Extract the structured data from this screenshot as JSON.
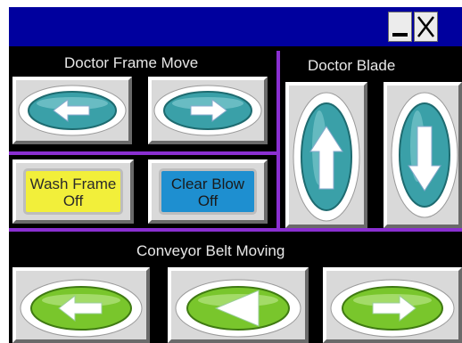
{
  "window": {
    "minimize_icon": "minimize-icon",
    "close_icon": "close-icon",
    "titlebar_color": "#00009e"
  },
  "doctor_frame_move": {
    "title": "Doctor Frame Move",
    "buttons": [
      {
        "icon": "arrow-left-icon",
        "color": "#3aa0a8"
      },
      {
        "icon": "arrow-right-icon",
        "color": "#3aa0a8"
      }
    ]
  },
  "doctor_blade": {
    "title": "Doctor Blade",
    "buttons": [
      {
        "icon": "arrow-up-icon",
        "color": "#3aa0a8"
      },
      {
        "icon": "arrow-down-icon",
        "color": "#3aa0a8"
      }
    ]
  },
  "wash_frame": {
    "label": "Wash Frame",
    "state": "Off",
    "color": "#f2ef3a"
  },
  "clear_blow": {
    "label": "Clear Blow",
    "state": "Off",
    "color": "#1e8fd0"
  },
  "conveyor_belt": {
    "title": "Conveyor Belt Moving",
    "buttons": [
      {
        "icon": "arrow-left-icon",
        "color": "#79c62c"
      },
      {
        "icon": "triangle-left-icon",
        "color": "#79c62c"
      },
      {
        "icon": "arrow-right-icon",
        "color": "#79c62c"
      }
    ]
  },
  "accent_divider_color": "#8a2fd1"
}
